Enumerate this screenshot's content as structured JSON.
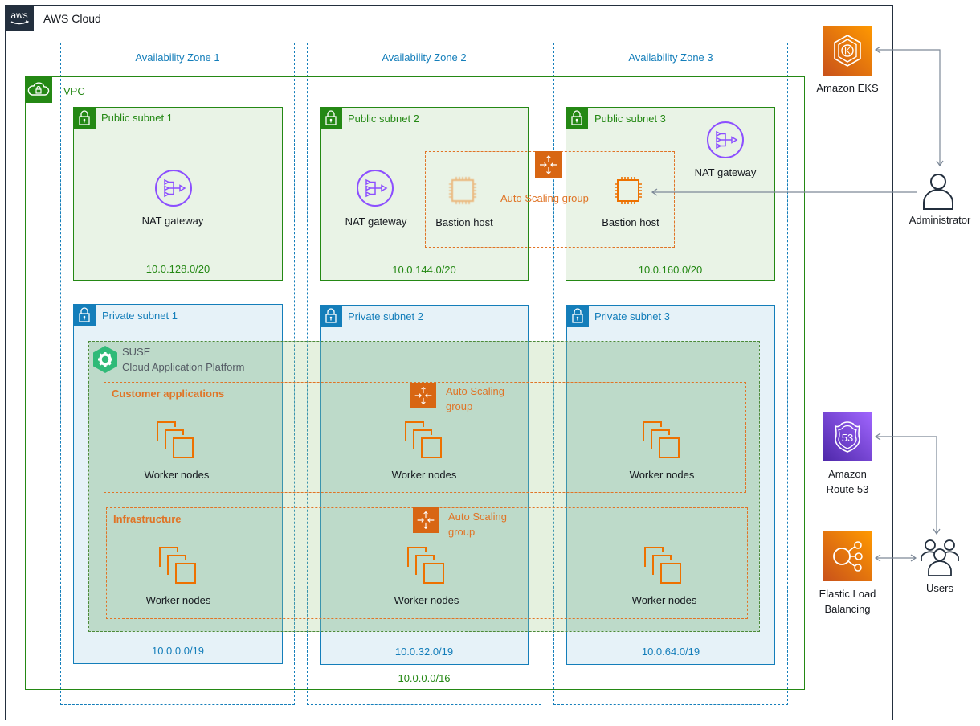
{
  "aws_cloud": {
    "label": "AWS Cloud",
    "logo": "aws-logo"
  },
  "availability_zones": [
    {
      "label": "Availability Zone 1"
    },
    {
      "label": "Availability Zone 2"
    },
    {
      "label": "Availability Zone 3"
    }
  ],
  "vpc": {
    "label": "VPC",
    "cidr": "10.0.0.0/16",
    "icon": "vpc-cloud-lock-icon"
  },
  "public_subnets": [
    {
      "label": "Public subnet 1",
      "cidr": "10.0.128.0/20",
      "nat": "NAT gateway"
    },
    {
      "label": "Public subnet 2",
      "cidr": "10.0.144.0/20",
      "nat": "NAT gateway",
      "bastion": "Bastion host"
    },
    {
      "label": "Public subnet 3",
      "cidr": "10.0.160.0/20",
      "nat": "NAT gateway",
      "bastion": "Bastion host"
    }
  ],
  "bastion_asg": {
    "label": "Auto Scaling group"
  },
  "private_subnets": [
    {
      "label": "Private subnet 1",
      "cidr": "10.0.0.0/19"
    },
    {
      "label": "Private subnet 2",
      "cidr": "10.0.32.0/19"
    },
    {
      "label": "Private subnet 3",
      "cidr": "10.0.64.0/19"
    }
  ],
  "suse": {
    "line1": "SUSE",
    "line2": "Cloud Application Platform",
    "icon_color": "#30ba78"
  },
  "customer_apps": {
    "title": "Customer applications",
    "asg_line1": "Auto Scaling",
    "asg_line2": "group",
    "nodes": [
      "Worker nodes",
      "Worker nodes",
      "Worker nodes"
    ]
  },
  "infrastructure": {
    "title": "Infrastructure",
    "asg_line1": "Auto Scaling",
    "asg_line2": "group",
    "nodes": [
      "Worker nodes",
      "Worker nodes",
      "Worker nodes"
    ]
  },
  "external": {
    "eks": {
      "label": "Amazon EKS"
    },
    "administrator": {
      "label": "Administrator"
    },
    "route53": {
      "line1": "Amazon",
      "line2": "Route 53"
    },
    "elb": {
      "line1": "Elastic Load",
      "line2": "Balancing"
    },
    "users": {
      "label": "Users"
    }
  },
  "colors": {
    "vpc_green": "#248814",
    "private_blue": "#147eba",
    "asg_orange": "#d86613",
    "nat_purple": "#8c4fff",
    "squid_ink": "#232f3e"
  }
}
